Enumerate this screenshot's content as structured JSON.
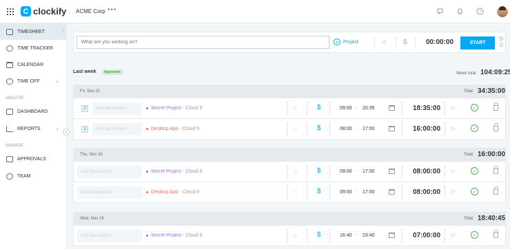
{
  "app": {
    "name": "clockify",
    "logo_letter": "C"
  },
  "header": {
    "workspace": "ACME Corp",
    "more": "•••"
  },
  "sidebar": {
    "items": [
      {
        "label": "TIMESHEET",
        "icon": "timesheet-icon",
        "active": true
      },
      {
        "label": "TIME TRACKER",
        "icon": "clock-icon"
      },
      {
        "label": "CALENDAR",
        "icon": "calendar-icon"
      },
      {
        "label": "TIME OFF",
        "icon": "time-off-icon"
      },
      {
        "label": "DASHBOARD",
        "icon": "dashboard-icon"
      },
      {
        "label": "REPORTS",
        "icon": "reports-icon"
      },
      {
        "label": "APPROVALS",
        "icon": "approvals-icon"
      },
      {
        "label": "TEAM",
        "icon": "team-icon"
      }
    ],
    "sections": {
      "analyze": "ANALYZE",
      "manage": "MANAGE"
    }
  },
  "tracker": {
    "placeholder": "What are you working on?",
    "project_label": "Project",
    "timer": "00:00:00",
    "start_label": "START"
  },
  "week": {
    "label": "Last week",
    "status": "Approved",
    "total_label": "Week total:",
    "total": "104:09:25"
  },
  "days": [
    {
      "date": "Fri, Nov 21",
      "total_label": "Total:",
      "total": "34:35:00",
      "entries": [
        {
          "group": "2",
          "desc": "Add description",
          "project": "Secret Project",
          "client": "Cloud 9",
          "color": "#9575cd",
          "start": "09:00",
          "end": "20:35",
          "duration": "18:35:00"
        },
        {
          "group": "3",
          "desc": "Add description",
          "project": "Desktop App",
          "client": "Cloud 9",
          "color": "#ff7043",
          "start": "08:00",
          "end": "17:00",
          "duration": "16:00:00"
        }
      ]
    },
    {
      "date": "Thu, Nov 20",
      "total_label": "Total:",
      "total": "16:00:00",
      "entries": [
        {
          "group": "",
          "desc": "Add description",
          "project": "Secret Project",
          "client": "Cloud 9",
          "color": "#9575cd",
          "start": "09:00",
          "end": "17:00",
          "duration": "08:00:00"
        },
        {
          "group": "",
          "desc": "Add description",
          "project": "Desktop App",
          "client": "Cloud 9",
          "color": "#ff7043",
          "start": "09:00",
          "end": "17:00",
          "duration": "08:00:00"
        }
      ]
    },
    {
      "date": "Wed, Nov 19",
      "total_label": "Total:",
      "total": "18:40:45",
      "entries": [
        {
          "group": "",
          "desc": "Add description",
          "project": "Secret Project",
          "client": "Cloud 9",
          "color": "#9575cd",
          "start": "16:40",
          "end": "23:40",
          "duration": "07:00:00"
        }
      ]
    }
  ],
  "separators": {
    "client": " - ",
    "time": "-"
  }
}
